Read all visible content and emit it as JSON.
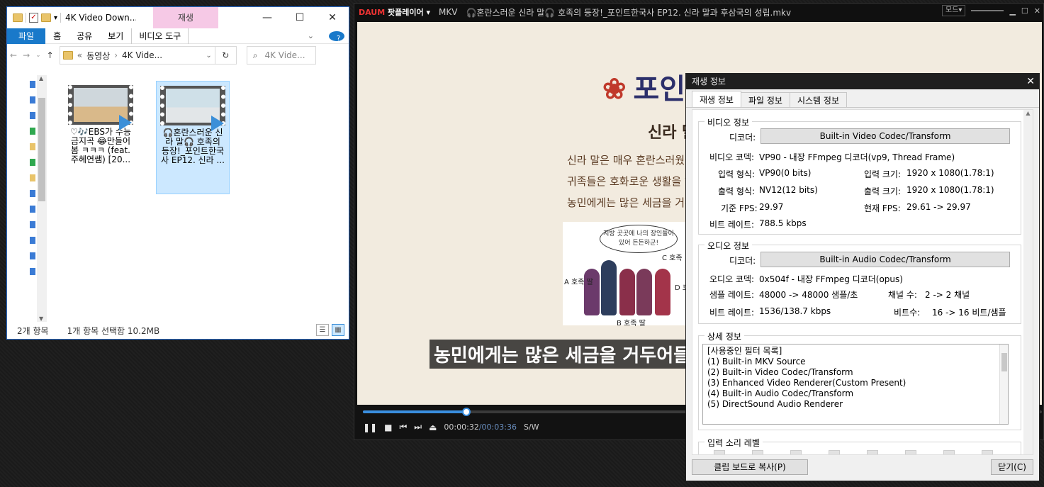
{
  "explorer": {
    "title": "4K Video Down...",
    "context_tab": "재생",
    "ribbon": [
      "파일",
      "홈",
      "공유",
      "보기",
      "비디오 도구"
    ],
    "nav": {
      "back": "←",
      "forward": "→",
      "up": "↑",
      "path_prefix": "«",
      "path": [
        "동영상",
        "4K Vide..."
      ],
      "chevron": "›",
      "dropdown": "⌄",
      "refresh": "↻"
    },
    "search_placeholder": "4K Vide...",
    "files": [
      {
        "name": "♡🎶EBS가 수능 금지곡 😂만들어 봄 ㅋㅋㅋ (feat. 주혜연쌤) [20...",
        "selected": false
      },
      {
        "name": "🎧혼란스러운 신라 말🎧 호족의 등장!_포인트한국사 EP12. 신라 ...",
        "selected": true
      }
    ],
    "status_count": "2개 항목",
    "status_selected": "1개 항목 선택함 10.2MB"
  },
  "player": {
    "logo_a": "DAUM",
    "logo_b": "팟플레이어",
    "format": "MKV",
    "title": "🎧혼란스러운 신라 말🎧 호족의 등장!_포인트한국사 EP12. 신라 말과 후삼국의 성립.mkv",
    "mode": "모드",
    "video": {
      "heading": "포인트 정",
      "sub": "신라 말",
      "lines": [
        "신라 말은 매우 혼란스러웠습",
        "귀족들은 호화로운 생활을 하",
        "농민에게는 많은 세금을 거두"
      ],
      "bubble": "지방 곳곳에 나의 장인들이 있어 든든하군!",
      "labels": {
        "a": "A 호족 딸",
        "b": "B 호족 딸",
        "c": "C 호족",
        "d": "D 호"
      },
      "subtitle": "농민에게는 많은 세금을 거두어들"
    },
    "progress": 0.152,
    "time_current": "00:00:32",
    "time_sep": "/",
    "time_total": "00:03:36",
    "renderer_tag": "S/W"
  },
  "info": {
    "title": "재생 정보",
    "tabs": [
      "재생 정보",
      "파일 정보",
      "시스템 정보"
    ],
    "video_group": "비디오 정보",
    "decoder_label": "디코더:",
    "video_decoder": "Built-in Video Codec/Transform",
    "video_codec_label": "비디오 코덱:",
    "video_codec": "VP90 - 내장 FFmpeg 디코더(vp9, Thread Frame)",
    "in_format_label": "입력 형식:",
    "in_format": "VP90(0 bits)",
    "in_size_label": "입력 크기:",
    "in_size": "1920 x 1080(1.78:1)",
    "out_format_label": "출력 형식:",
    "out_format": "NV12(12 bits)",
    "out_size_label": "출력 크기:",
    "out_size": "1920 x 1080(1.78:1)",
    "base_fps_label": "기준 FPS:",
    "base_fps": "29.97",
    "cur_fps_label": "현재 FPS:",
    "cur_fps": "29.61 -> 29.97",
    "bitrate_label": "비트 레이트:",
    "video_bitrate": "788.5 kbps",
    "audio_group": "오디오 정보",
    "audio_decoder": "Built-in Audio Codec/Transform",
    "audio_codec_label": "오디오 코덱:",
    "audio_codec": "0x504f - 내장 FFmpeg 디코더(opus)",
    "sample_rate_label": "샘플 레이트:",
    "sample_rate": "48000 -> 48000 샘플/초",
    "channels_label": "채널 수:",
    "channels": "2 -> 2 채널",
    "audio_bitrate": "1536/138.7 kbps",
    "bits_label": "비트수:",
    "bits": "16 -> 16 비트/샘플",
    "detail_group": "상세 정보",
    "filters": [
      "[사용중인 필터 목록]",
      "(1) Built-in MKV Source",
      "(2) Built-in Video Codec/Transform",
      "(3) Enhanced Video Renderer(Custom Present)",
      "(4) Built-in Audio Codec/Transform",
      "(5) DirectSound Audio Renderer"
    ],
    "level_group": "입력 소리 레벨",
    "copy_btn": "클립 보드로 복사(P)",
    "close_btn": "닫기(C)"
  }
}
